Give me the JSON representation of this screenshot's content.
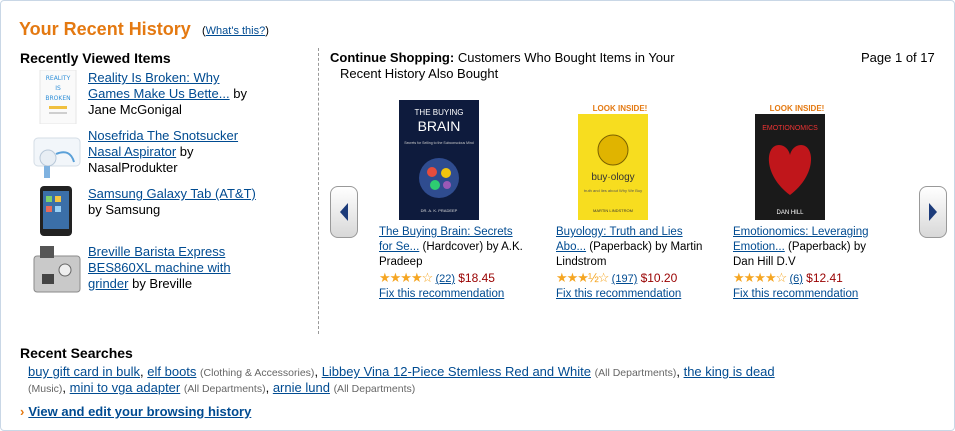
{
  "header": {
    "title": "Your Recent History",
    "whats_this_open": "(",
    "whats_this": "What's this?",
    "whats_this_close": ")"
  },
  "recently_viewed": {
    "heading": "Recently Viewed Items",
    "items": [
      {
        "title_line1": "Reality Is Broken: Why",
        "title_line2": "Games Make Us Bette...",
        "by": "by",
        "author": "Jane McGonigal",
        "thumb_text": [
          "REALITY",
          "IS",
          "BROKEN"
        ]
      },
      {
        "title_line1": "Nosefrida The Snotsucker",
        "title_line2": "Nasal Aspirator",
        "by": "by",
        "author": "NasalProdukter"
      },
      {
        "title_line1": "Samsung Galaxy Tab (AT&T)",
        "by": "by Samsung"
      },
      {
        "title_line1": "Breville Barista Express",
        "title_line2": "BES860XL machine with",
        "title_line3": "grinder",
        "by": "by Breville"
      }
    ]
  },
  "continue": {
    "label": "Continue Shopping:",
    "text_line1": "Customers Who Bought Items in Your",
    "text_line2": "Recent History Also Bought",
    "page_info": "Page 1 of 17",
    "products": [
      {
        "title_line1": "The Buying Brain: Secrets",
        "title_line2": "for Se...",
        "format": "(Hardcover) by A.K.",
        "author": "Pradeep",
        "reviews": "(22)",
        "price": "$18.45",
        "fix": "Fix this recommendation",
        "stars": "★★★★☆",
        "cover_title1": "THE BUYING",
        "cover_title2": "BRAIN",
        "cover_sub": "Secrets for Selling to the Subconscious Mind",
        "cover_author": "DR. A. K. PRADEEP"
      },
      {
        "title_line1": "Buyology: Truth and Lies",
        "title_line2": "Abo...",
        "format": "(Paperback) by Martin",
        "author": "Lindstrom",
        "reviews": "(197)",
        "price": "$10.20",
        "fix": "Fix this recommendation",
        "stars": "★★★½☆",
        "look_inside": "LOOK INSIDE!",
        "cover_title": "buy·ology",
        "cover_sub": "truth and lies about Why We Buy",
        "cover_author": "MARTIN LINDSTROM"
      },
      {
        "title_line1": "Emotionomics: Leveraging",
        "title_line2": "Emotion...",
        "format": "(Paperback) by",
        "author": "Dan Hill D.V",
        "reviews": "(6)",
        "price": "$12.41",
        "fix": "Fix this recommendation",
        "stars": "★★★★☆",
        "look_inside": "LOOK INSIDE!",
        "cover_title": "EMOTIONOMICS",
        "cover_author": "DAN HILL"
      }
    ]
  },
  "recent_searches": {
    "heading": "Recent Searches",
    "items": [
      {
        "term": "buy gift card in bulk",
        "cat": "",
        "sep": ","
      },
      {
        "term": "elf boots",
        "cat": "(Clothing & Accessories)",
        "sep": ","
      },
      {
        "term": "Libbey Vina 12-Piece Stemless Red and White",
        "cat": "(All Departments)",
        "sep": ","
      },
      {
        "term": "the king is dead",
        "cat": "",
        "sep": ""
      },
      {
        "term": "",
        "cat": "(Music)",
        "sep": ","
      },
      {
        "term": "mini to vga adapter",
        "cat": "(All Departments)",
        "sep": ","
      },
      {
        "term": "arnie lund",
        "cat": "(All Departments)",
        "sep": ""
      }
    ]
  },
  "footer": {
    "chevron": "›",
    "link": "View and edit your browsing history"
  },
  "colors": {
    "accent": "#e47911",
    "link": "#004b91",
    "price": "#990000",
    "star": "#f5a623"
  }
}
